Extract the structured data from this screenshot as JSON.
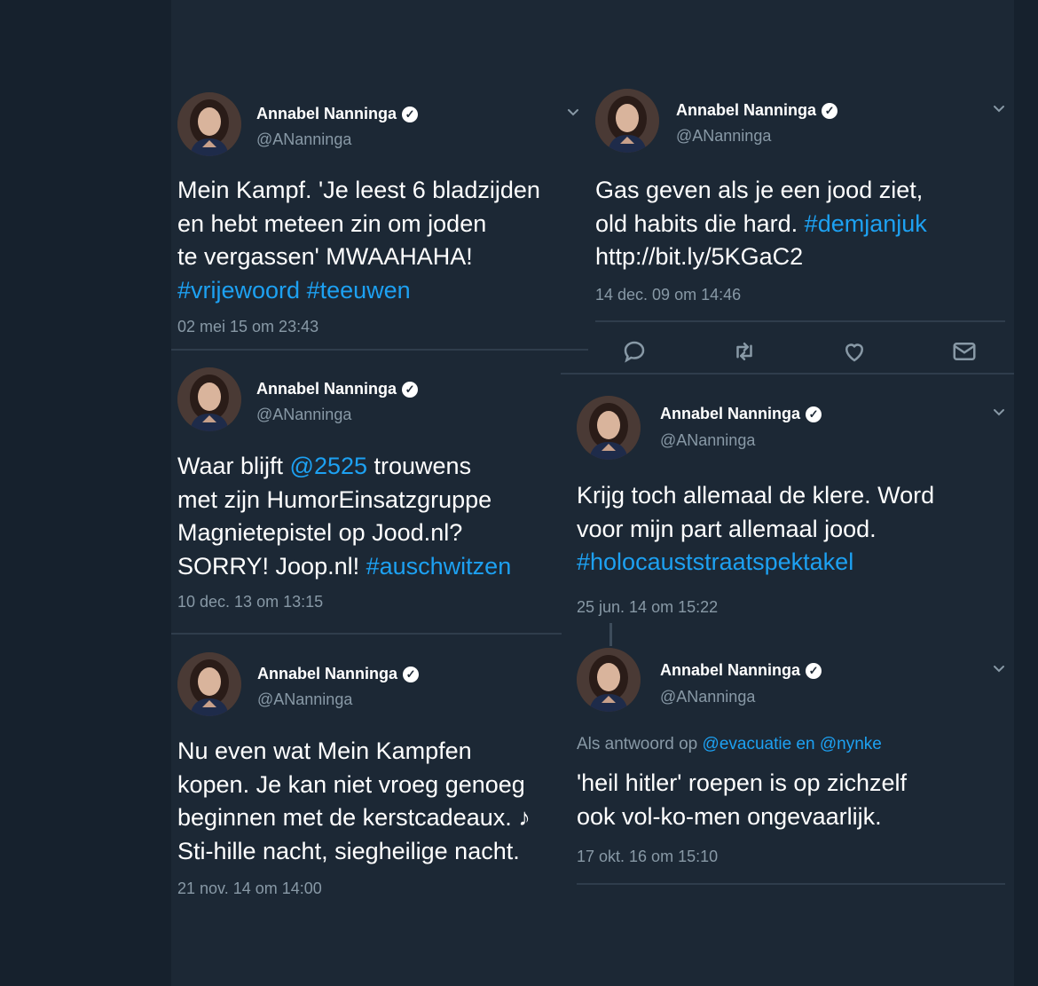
{
  "user": {
    "name": "Annabel Nanninga",
    "handle": "@ANanninga"
  },
  "tweets": [
    {
      "lines": [
        [
          {
            "t": "Mein Kampf. 'Je leest 6 bladzijden"
          }
        ],
        [
          {
            "t": "en hebt meteen zin om joden"
          }
        ],
        [
          {
            "t": "te vergassen' MWAAHAHA!"
          }
        ],
        [
          {
            "t": "#vrijewoord",
            "link": true
          },
          {
            "t": " "
          },
          {
            "t": "#teeuwen",
            "link": true
          }
        ]
      ],
      "time": "02 mei 15 om 23:43"
    },
    {
      "lines": [
        [
          {
            "t": "Gas geven als je een jood ziet,"
          }
        ],
        [
          {
            "t": "old habits die hard. "
          },
          {
            "t": "#demjanjuk",
            "link": true
          }
        ],
        [
          {
            "t": "http://bit.ly/5KGaC2"
          }
        ]
      ],
      "time": "14 dec. 09 om 14:46"
    },
    {
      "lines": [
        [
          {
            "t": "Waar blijft "
          },
          {
            "t": "@2525",
            "link": true
          },
          {
            "t": " trouwens"
          }
        ],
        [
          {
            "t": "met zijn HumorEinsatzgruppe"
          }
        ],
        [
          {
            "t": "Magnietepistel op Jood.nl?"
          }
        ],
        [
          {
            "t": "SORRY! Joop.nl! "
          },
          {
            "t": "#auschwitzen",
            "link": true
          }
        ]
      ],
      "time": "10 dec. 13 om 13:15"
    },
    {
      "lines": [
        [
          {
            "t": "Krijg toch allemaal de klere. Word"
          }
        ],
        [
          {
            "t": "voor mijn part allemaal jood."
          }
        ],
        [
          {
            "t": "#holocauststraatspektakel",
            "link": true
          }
        ]
      ],
      "time": "25 jun. 14 om 15:22"
    },
    {
      "lines": [
        [
          {
            "t": "Nu even wat Mein Kampfen"
          }
        ],
        [
          {
            "t": "kopen. Je kan niet vroeg genoeg"
          }
        ],
        [
          {
            "t": "beginnen met de kerstcadeaux. ♪"
          }
        ],
        [
          {
            "t": "Sti-hille nacht, siegheilige nacht."
          }
        ]
      ],
      "time": "21 nov. 14 om 14:00"
    },
    {
      "reply_to": [
        {
          "t": "Als antwoord op "
        },
        {
          "t": "@evacuatie en @nynke",
          "link": true
        }
      ],
      "lines": [
        [
          {
            "t": "'heil hitler' roepen is op zichzelf"
          }
        ],
        [
          {
            "t": "ook vol-ko-men ongevaarlijk."
          }
        ]
      ],
      "time": "17 okt. 16 om 15:10"
    }
  ],
  "icons": {
    "reply": "reply-icon",
    "retweet": "retweet-icon",
    "like": "like-icon",
    "message": "message-icon",
    "verified": "verified-badge-icon",
    "menu": "chevron-down-icon"
  },
  "colors": {
    "background": "#1c2835",
    "link": "#1da1f2",
    "secondary_text": "#8899a6"
  }
}
